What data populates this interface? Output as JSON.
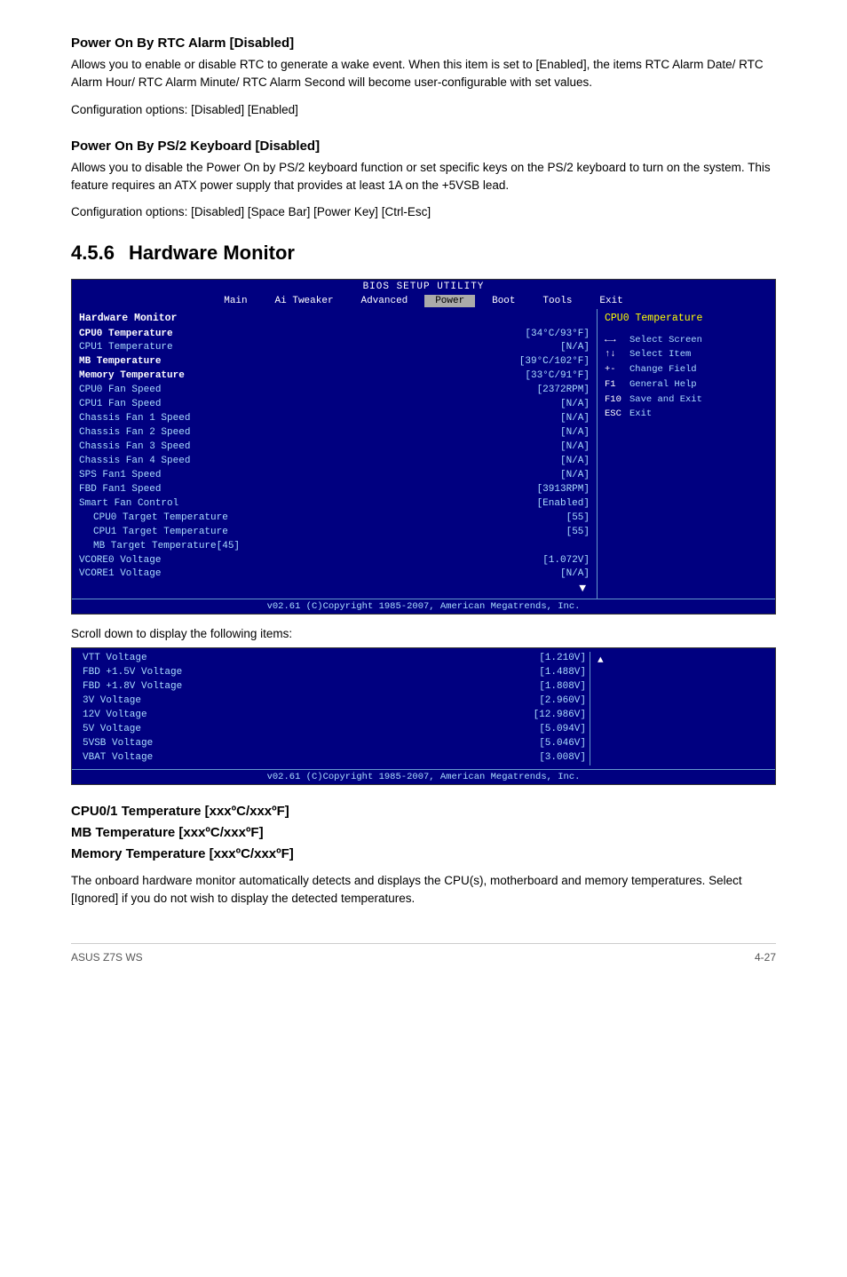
{
  "page": {
    "footer_left": "ASUS Z7S WS",
    "footer_right": "4-27"
  },
  "sections": [
    {
      "id": "power_rtc",
      "title": "Power On By RTC Alarm [Disabled]",
      "paragraphs": [
        "Allows you to enable or disable RTC to generate a wake event. When this item is set to [Enabled], the items RTC Alarm Date/ RTC Alarm Hour/ RTC Alarm Minute/ RTC Alarm Second will become user-configurable with set values.",
        "Configuration options: [Disabled] [Enabled]"
      ]
    },
    {
      "id": "power_ps2",
      "title": "Power On By PS/2 Keyboard [Disabled]",
      "paragraphs": [
        "Allows you to disable the Power On by PS/2 keyboard function or set specific keys on the PS/2 keyboard to turn on the system. This feature requires an ATX power supply that provides at least 1A on the +5VSB lead.",
        "Configuration options: [Disabled] [Space Bar] [Power Key] [Ctrl-Esc]"
      ]
    }
  ],
  "chapter": {
    "num": "4.5.6",
    "title": "Hardware Monitor"
  },
  "bios": {
    "header": "BIOS SETUP UTILITY",
    "tabs": [
      "Main",
      "Ai Tweaker",
      "Advanced",
      "Power",
      "Boot",
      "Tools",
      "Exit"
    ],
    "active_tab": "Power",
    "section_title": "Hardware Monitor",
    "rows": [
      {
        "label": "CPU0 Temperature",
        "value": "[34°C/93°F]",
        "bold": true
      },
      {
        "label": "CPU1 Temperature",
        "value": "[N/A]",
        "bold": false
      },
      {
        "label": "MB Temperature",
        "value": "[39°C/102°F]",
        "bold": true
      },
      {
        "label": "Memory Temperature",
        "value": "[33°C/91°F]",
        "bold": true
      },
      {
        "label": "CPU0 Fan Speed",
        "value": "[2372RPM]",
        "bold": false
      },
      {
        "label": "CPU1 Fan Speed",
        "value": "[N/A]",
        "bold": false
      },
      {
        "label": "Chassis Fan 1 Speed",
        "value": "[N/A]",
        "bold": false
      },
      {
        "label": "Chassis Fan 2 Speed",
        "value": "[N/A]",
        "bold": false
      },
      {
        "label": "Chassis Fan 3 Speed",
        "value": "[N/A]",
        "bold": false
      },
      {
        "label": "Chassis Fan 4 Speed",
        "value": "[N/A]",
        "bold": false
      },
      {
        "label": "SPS Fan1 Speed",
        "value": "[N/A]",
        "bold": false
      },
      {
        "label": "FBD Fan1 Speed",
        "value": "[3913RPM]",
        "bold": false
      },
      {
        "label": "Smart Fan Control",
        "value": "[Enabled]",
        "bold": false
      },
      {
        "label": "CPU0 Target Temperature",
        "value": "[55]",
        "bold": false,
        "indent": true
      },
      {
        "label": "CPU1 Target Temperature",
        "value": "[55]",
        "bold": false,
        "indent": true
      },
      {
        "label": "MB Target Temperature[45]",
        "value": "",
        "bold": false,
        "indent": true
      },
      {
        "label": "VCORE0 Voltage",
        "value": "[1.072V]",
        "bold": false
      },
      {
        "label": "VCORE1 Voltage",
        "value": "[N/A]",
        "bold": false
      }
    ],
    "right_title": "CPU0 Temperature",
    "right_desc": "",
    "keys": [
      {
        "sym": "←→",
        "desc": "Select Screen"
      },
      {
        "sym": "↑↓",
        "desc": "Select Item"
      },
      {
        "sym": "+-",
        "desc": "Change Field"
      },
      {
        "sym": "F1",
        "desc": "General Help"
      },
      {
        "sym": "F10",
        "desc": "Save and Exit"
      },
      {
        "sym": "ESC",
        "desc": "Exit"
      }
    ],
    "footer": "v02.61 (C)Copyright 1985-2007, American Megatrends, Inc."
  },
  "scroll_note": "Scroll down to display the following items:",
  "bios2": {
    "rows": [
      {
        "label": "VTT Voltage",
        "value": "[1.210V]"
      },
      {
        "label": "FBD +1.5V Voltage",
        "value": "[1.488V]"
      },
      {
        "label": "FBD +1.8V Voltage",
        "value": "[1.808V]"
      },
      {
        "label": "3V Voltage",
        "value": "[2.960V]"
      },
      {
        "label": "12V Voltage",
        "value": "[12.986V]"
      },
      {
        "label": "5V Voltage",
        "value": "[5.094V]"
      },
      {
        "label": "5VSB Voltage",
        "value": "[5.046V]"
      },
      {
        "label": "VBAT Voltage",
        "value": "[3.008V]"
      }
    ],
    "footer": "v02.61 (C)Copyright 1985-2007, American Megatrends, Inc."
  },
  "cpu_section": {
    "heading_lines": [
      "CPU0/1 Temperature [xxxºC/xxxºF]",
      "MB Temperature [xxxºC/xxxºF]",
      "Memory Temperature [xxxºC/xxxºF]"
    ],
    "body": "The onboard hardware monitor automatically detects and displays the CPU(s), motherboard and memory temperatures. Select [Ignored] if you do not wish to display the detected temperatures."
  }
}
